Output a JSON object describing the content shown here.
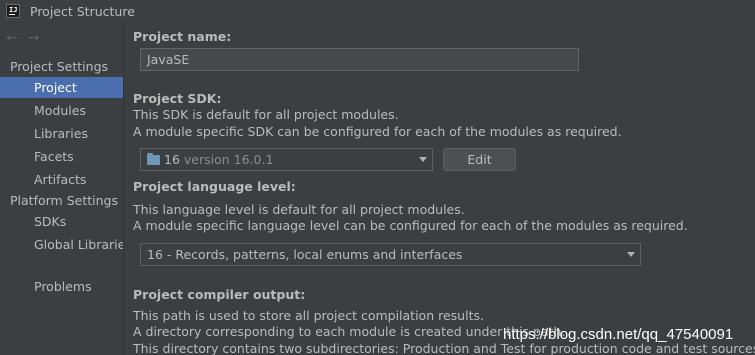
{
  "window": {
    "title": "Project Structure",
    "icon_text": "IJ"
  },
  "nav": {
    "back_icon": "←",
    "forward_icon": "→"
  },
  "sidebar": {
    "project_settings_label": "Project Settings",
    "project_settings_items": [
      {
        "label": "Project",
        "selected": true
      },
      {
        "label": "Modules",
        "selected": false
      },
      {
        "label": "Libraries",
        "selected": false
      },
      {
        "label": "Facets",
        "selected": false
      },
      {
        "label": "Artifacts",
        "selected": false
      }
    ],
    "platform_settings_label": "Platform Settings",
    "platform_settings_items": [
      {
        "label": "SDKs",
        "selected": false
      },
      {
        "label": "Global Libraries",
        "selected": false
      }
    ],
    "problems_label": "Problems"
  },
  "main": {
    "project_name": {
      "heading": "Project name:",
      "value": "JavaSE"
    },
    "project_sdk": {
      "heading": "Project SDK:",
      "desc1": "This SDK is default for all project modules.",
      "desc2": "A module specific SDK can be configured for each of the modules as required.",
      "selected_name": "16",
      "selected_version": "version 16.0.1",
      "edit_label": "Edit"
    },
    "language_level": {
      "heading": "Project language level:",
      "desc1": "This language level is default for all project modules.",
      "desc2": "A module specific language level can be configured for each of the modules as required.",
      "selected": "16 - Records, patterns, local enums and interfaces"
    },
    "compiler_output": {
      "heading": "Project compiler output:",
      "desc1": "This path is used to store all project compilation results.",
      "desc2": "A directory corresponding to each module is created under this path.",
      "desc3": "This directory contains two subdirectories: Production and Test for production code and test sources, resp"
    }
  },
  "watermark": "https://blog.csdn.net/qq_47540091",
  "colors": {
    "background": "#3c3f41",
    "selection": "#4b6eaf",
    "text": "#bbbbbb",
    "input_bg": "#45494a"
  }
}
